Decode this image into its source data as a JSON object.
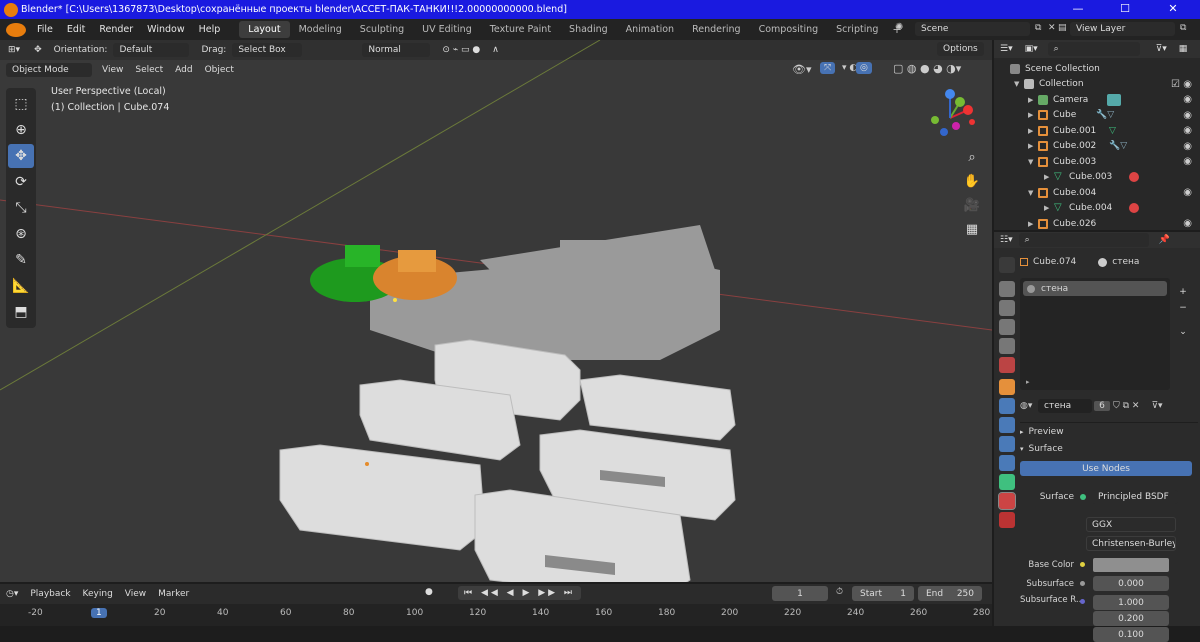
{
  "window": {
    "title": "Blender* [C:\\Users\\1367873\\Desktop\\сохранённые проекты blender\\АССЕТ-ПАК-ТАНКИ!!!2.00000000000.blend]"
  },
  "menu": [
    "File",
    "Edit",
    "Render",
    "Window",
    "Help"
  ],
  "workspaces": [
    {
      "label": "Layout",
      "active": true
    },
    {
      "label": "Modeling"
    },
    {
      "label": "Sculpting"
    },
    {
      "label": "UV Editing"
    },
    {
      "label": "Texture Paint"
    },
    {
      "label": "Shading"
    },
    {
      "label": "Animation"
    },
    {
      "label": "Rendering"
    },
    {
      "label": "Compositing"
    },
    {
      "label": "Scripting"
    }
  ],
  "scene": {
    "name": "Scene",
    "view_layer": "View Layer"
  },
  "tool_header": {
    "orientation_label": "Orientation:",
    "orientation": "Default",
    "drag_label": "Drag:",
    "drag": "Select Box",
    "pivot": "Normal",
    "options": "Options"
  },
  "viewport_header": {
    "mode": "Object Mode",
    "menus": [
      "View",
      "Select",
      "Add",
      "Object"
    ]
  },
  "viewport_info": {
    "line1": "User Perspective (Local)",
    "line2": "(1) Collection | Cube.074"
  },
  "outliner": {
    "root": "Scene Collection",
    "items": [
      {
        "label": "Collection",
        "indent": 1,
        "type": "collection"
      },
      {
        "label": "Camera",
        "indent": 2,
        "type": "camera"
      },
      {
        "label": "Cube",
        "indent": 2,
        "type": "mesh"
      },
      {
        "label": "Cube.001",
        "indent": 2,
        "type": "mesh"
      },
      {
        "label": "Cube.002",
        "indent": 2,
        "type": "mesh"
      },
      {
        "label": "Cube.003",
        "indent": 2,
        "type": "mesh"
      },
      {
        "label": "Cube.003",
        "indent": 3,
        "type": "data"
      },
      {
        "label": "Cube.004",
        "indent": 2,
        "type": "mesh"
      },
      {
        "label": "Cube.004",
        "indent": 3,
        "type": "data"
      },
      {
        "label": "Cube.026",
        "indent": 2,
        "type": "mesh"
      }
    ]
  },
  "properties": {
    "object": "Cube.074",
    "material": "стена",
    "slot": "стена",
    "mat_field": "стена",
    "users": "6",
    "preview": "Preview",
    "surface": "Surface",
    "use_nodes": "Use Nodes",
    "surface_label": "Surface",
    "shader": "Principled BSDF",
    "distribution": "GGX",
    "subsurface_method": "Christensen-Burley",
    "base_color_label": "Base Color",
    "base_color": "#8f8f8f",
    "subsurface_label": "Subsurface",
    "subsurface": "0.000",
    "subsurface_r_label": "Subsurface R...",
    "subsurface_r": [
      "1.000",
      "0.200",
      "0.100"
    ]
  },
  "timeline": {
    "menus": [
      "Playback",
      "Keying",
      "View",
      "Marker"
    ],
    "current": "1",
    "start_label": "Start",
    "start": "1",
    "end_label": "End",
    "end": "250",
    "ticks": [
      "-20",
      "1",
      "20",
      "40",
      "60",
      "80",
      "100",
      "120",
      "140",
      "160",
      "180",
      "200",
      "220",
      "240",
      "260",
      "280"
    ]
  },
  "colors": {
    "accent": "#4772b3",
    "title": "#1a1ae0",
    "mesh": "#e5903b",
    "data": "#3fc07f"
  }
}
